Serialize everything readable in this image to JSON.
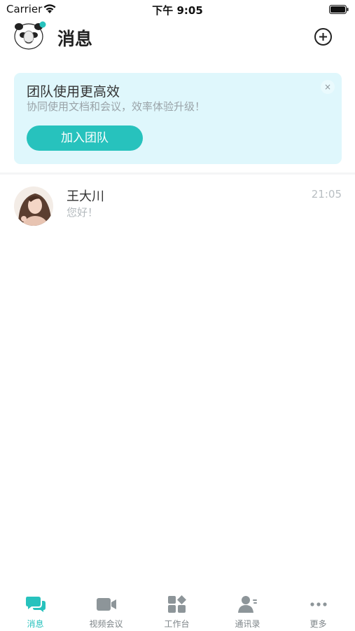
{
  "status_bar": {
    "carrier": "Carrier",
    "time": "下午 9:05"
  },
  "header": {
    "title": "消息"
  },
  "banner": {
    "title": "团队使用更高效",
    "subtitle": "协同使用文档和会议，效率体验升级！",
    "close_label": "×",
    "join_label": "加入团队"
  },
  "conversations": [
    {
      "name": "王大川",
      "last_message": "您好！",
      "time": "21:05"
    }
  ],
  "tabs": [
    {
      "label": "消息",
      "icon": "chat-bubbles-icon",
      "active": true
    },
    {
      "label": "视频会议",
      "icon": "video-camera-icon",
      "active": false
    },
    {
      "label": "工作台",
      "icon": "apps-grid-icon",
      "active": false
    },
    {
      "label": "通讯录",
      "icon": "contacts-icon",
      "active": false
    },
    {
      "label": "更多",
      "icon": "more-dots-icon",
      "active": false
    }
  ],
  "colors": {
    "accent": "#27c2bd",
    "banner_bg": "#dff7fc",
    "tab_inactive": "#8d9599"
  }
}
